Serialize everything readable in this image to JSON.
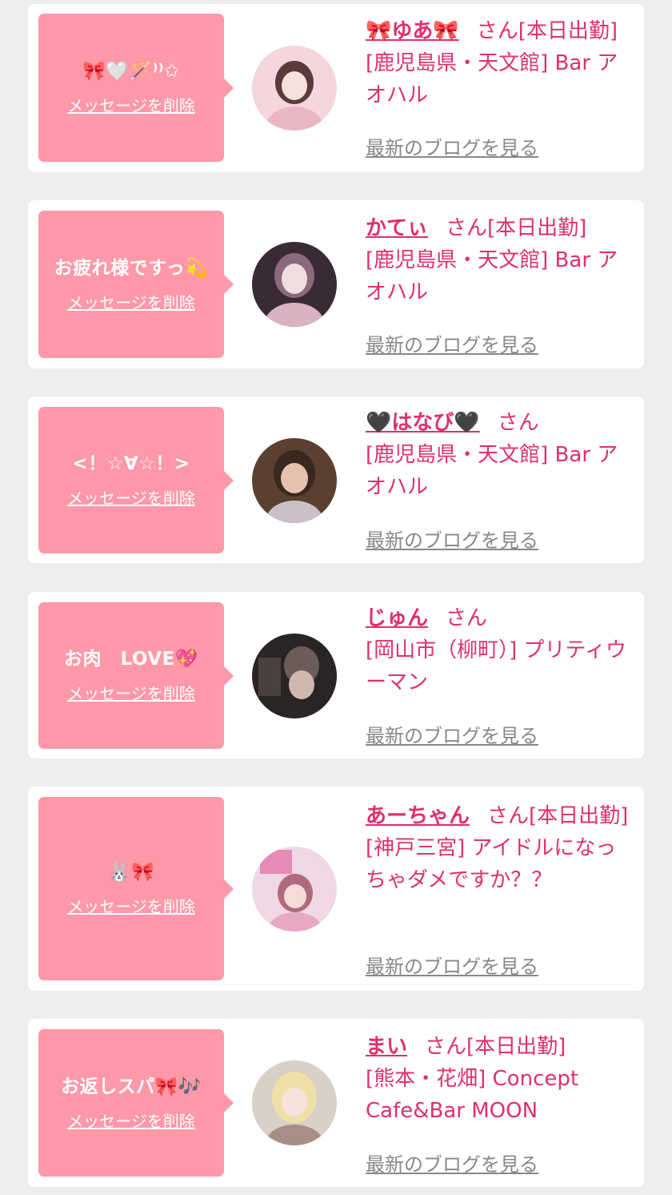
{
  "cards": [
    {
      "message": "🎀🤍🪄⁾⁾✩",
      "delete_label": "メッセージを削除",
      "name": "🎀ゆあ🎀",
      "san": "さん",
      "status": "[本日出勤]",
      "shop": "[鹿児島県・天文館] Bar アオハル",
      "blog_label": "最新のブログを見る",
      "avatar_colors": [
        "#f4d6dc",
        "#e9b7c4",
        "#5a3a3a"
      ]
    },
    {
      "message": "お疲れ様ですっ💫",
      "delete_label": "メッセージを削除",
      "name": "かてぃ",
      "san": "さん",
      "status": "[本日出勤]",
      "shop": "[鹿児島県・天文館] Bar アオハル",
      "blog_label": "最新のブログを見る",
      "avatar_colors": [
        "#3a2a35",
        "#d9b3c2",
        "#8b6a7d"
      ]
    },
    {
      "message": "<！☆∀☆！>",
      "delete_label": "メッセージを削除",
      "name": "🖤はなび🖤",
      "san": "さん",
      "status": "",
      "shop": "[鹿児島県・天文館] Bar アオハル",
      "blog_label": "最新のブログを見る",
      "avatar_colors": [
        "#5a4030",
        "#e5c2b0",
        "#3a2820"
      ]
    },
    {
      "message": "お肉　LOVE💖",
      "delete_label": "メッセージを削除",
      "name": "じゅん",
      "san": "さん",
      "status": "",
      "shop": "[岡山市（柳町）] プリティウーマン",
      "blog_label": "最新のブログを見る",
      "avatar_colors": [
        "#2a2424",
        "#cfb8b0",
        "#6b5c58"
      ]
    },
    {
      "message": "🐰🎀",
      "delete_label": "メッセージを削除",
      "name": "あーちゃん",
      "san": "さん",
      "status": "[本日出勤]",
      "shop": "[神戸三宮] アイドルになっちゃダメですか？？",
      "blog_label": "最新のブログを見る",
      "avatar_colors": [
        "#f0d8e6",
        "#e58bb5",
        "#b06a7e"
      ]
    },
    {
      "message": "お返しスパ🎀🎶",
      "delete_label": "メッセージを削除",
      "name": "まい",
      "san": "さん",
      "status": "[本日出勤]",
      "shop": "[熊本・花畑] Concept Cafe&Bar MOON",
      "blog_label": "最新のブログを見る",
      "avatar_colors": [
        "#d9d0c8",
        "#efe0a8",
        "#a88f86"
      ]
    }
  ]
}
